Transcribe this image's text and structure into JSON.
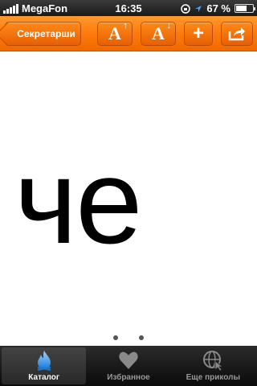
{
  "status_bar": {
    "carrier": "MegaFon",
    "time": "16:35",
    "battery": "67 %",
    "battery_level": 0.67
  },
  "nav": {
    "back_label": "Секретарши",
    "font_increase_icon": "font-size-increase-icon",
    "font_decrease_icon": "font-size-decrease-icon",
    "add_icon": "plus-icon",
    "share_icon": "share-icon",
    "accent_color": "#ff7a0d"
  },
  "content": {
    "text": "че",
    "page_count": 2,
    "current_page": 1
  },
  "tabs": [
    {
      "label": "Каталог",
      "icon": "flame-icon",
      "active": true
    },
    {
      "label": "Избранное",
      "icon": "heart-icon",
      "active": false
    },
    {
      "label": "Еще приколы",
      "icon": "globe-icon",
      "active": false
    }
  ]
}
